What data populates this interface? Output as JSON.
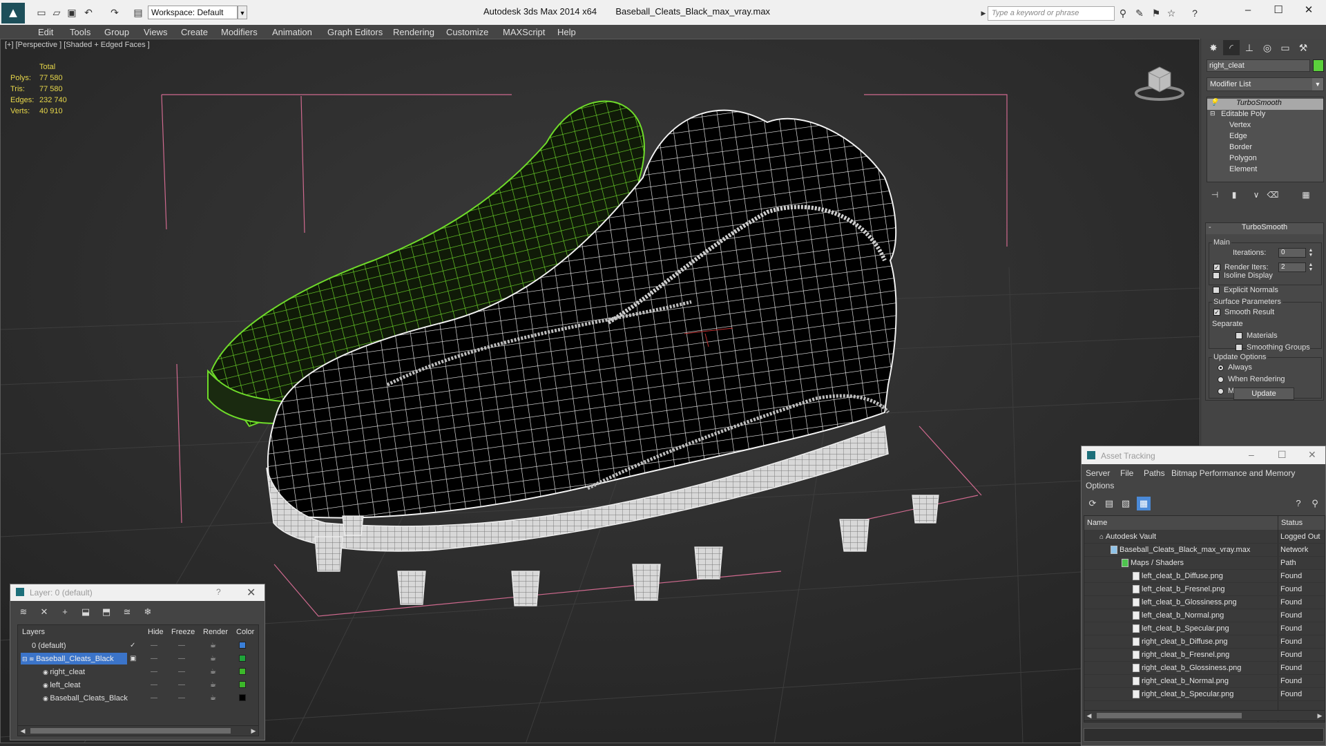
{
  "titlebar": {
    "workspace": "Workspace: Default",
    "app_title": "Autodesk 3ds Max  2014 x64",
    "file_title": "Baseball_Cleats_Black_max_vray.max",
    "search_placeholder": "Type a keyword or phrase"
  },
  "menu": [
    "Edit",
    "Tools",
    "Group",
    "Views",
    "Create",
    "Modifiers",
    "Animation",
    "Graph Editors",
    "Rendering",
    "Customize",
    "MAXScript",
    "Help"
  ],
  "viewport": {
    "label": "[+] [Perspective ] [Shaded + Edged Faces ]",
    "stats": {
      "header": "Total",
      "rows": [
        {
          "label": "Polys:",
          "value": "77 580"
        },
        {
          "label": "Tris:",
          "value": "77 580"
        },
        {
          "label": "Edges:",
          "value": "232 740"
        },
        {
          "label": "Verts:",
          "value": "40 910"
        }
      ]
    }
  },
  "command_panel": {
    "object_name": "right_cleat",
    "object_color": "#5bd03c",
    "modifier_list": "Modifier List",
    "stack": [
      "TurboSmooth",
      "Editable Poly",
      "Vertex",
      "Edge",
      "Border",
      "Polygon",
      "Element"
    ],
    "turbosmooth": {
      "title": "TurboSmooth",
      "main_group": "Main",
      "iterations_label": "Iterations:",
      "iterations_value": "0",
      "render_iters_label": "Render Iters:",
      "render_iters_value": "2",
      "isoline": "Isoline Display",
      "explicit_normals": "Explicit Normals",
      "surface_group": "Surface Parameters",
      "smooth_result": "Smooth Result",
      "separate": "Separate",
      "materials": "Materials",
      "smoothing_groups": "Smoothing Groups",
      "update_group": "Update Options",
      "always": "Always",
      "when_rendering": "When Rendering",
      "manually": "Manually",
      "update_btn": "Update"
    }
  },
  "layer_window": {
    "title": "Layer: 0 (default)",
    "help": "?",
    "columns": [
      "Layers",
      "Hide",
      "Freeze",
      "Render",
      "Color"
    ],
    "rows": [
      {
        "name": "0 (default)",
        "color": "#3a7fd8"
      },
      {
        "name": "Baseball_Cleats_Black",
        "color": "#1fa33a"
      },
      {
        "name": "right_cleat",
        "color": "#3cb82a"
      },
      {
        "name": "left_cleat",
        "color": "#3cb82a"
      },
      {
        "name": "Baseball_Cleats_Black",
        "color": "#000000"
      }
    ]
  },
  "asset_window": {
    "title": "Asset Tracking",
    "menu": [
      "Server",
      "File",
      "Paths",
      "Bitmap Performance and Memory",
      "Options"
    ],
    "columns": [
      "Name",
      "Status"
    ],
    "rows": [
      {
        "name": "Autodesk Vault",
        "status": "Logged Out"
      },
      {
        "name": "Baseball_Cleats_Black_max_vray.max",
        "status": "Network Path"
      },
      {
        "name": "Maps / Shaders",
        "status": ""
      },
      {
        "name": "left_cleat_b_Diffuse.png",
        "status": "Found"
      },
      {
        "name": "left_cleat_b_Fresnel.png",
        "status": "Found"
      },
      {
        "name": "left_cleat_b_Glossiness.png",
        "status": "Found"
      },
      {
        "name": "left_cleat_b_Normal.png",
        "status": "Found"
      },
      {
        "name": "left_cleat_b_Specular.png",
        "status": "Found"
      },
      {
        "name": "right_cleat_b_Diffuse.png",
        "status": "Found"
      },
      {
        "name": "right_cleat_b_Fresnel.png",
        "status": "Found"
      },
      {
        "name": "right_cleat_b_Glossiness.png",
        "status": "Found"
      },
      {
        "name": "right_cleat_b_Normal.png",
        "status": "Found"
      },
      {
        "name": "right_cleat_b_Specular.png",
        "status": "Found"
      }
    ]
  }
}
